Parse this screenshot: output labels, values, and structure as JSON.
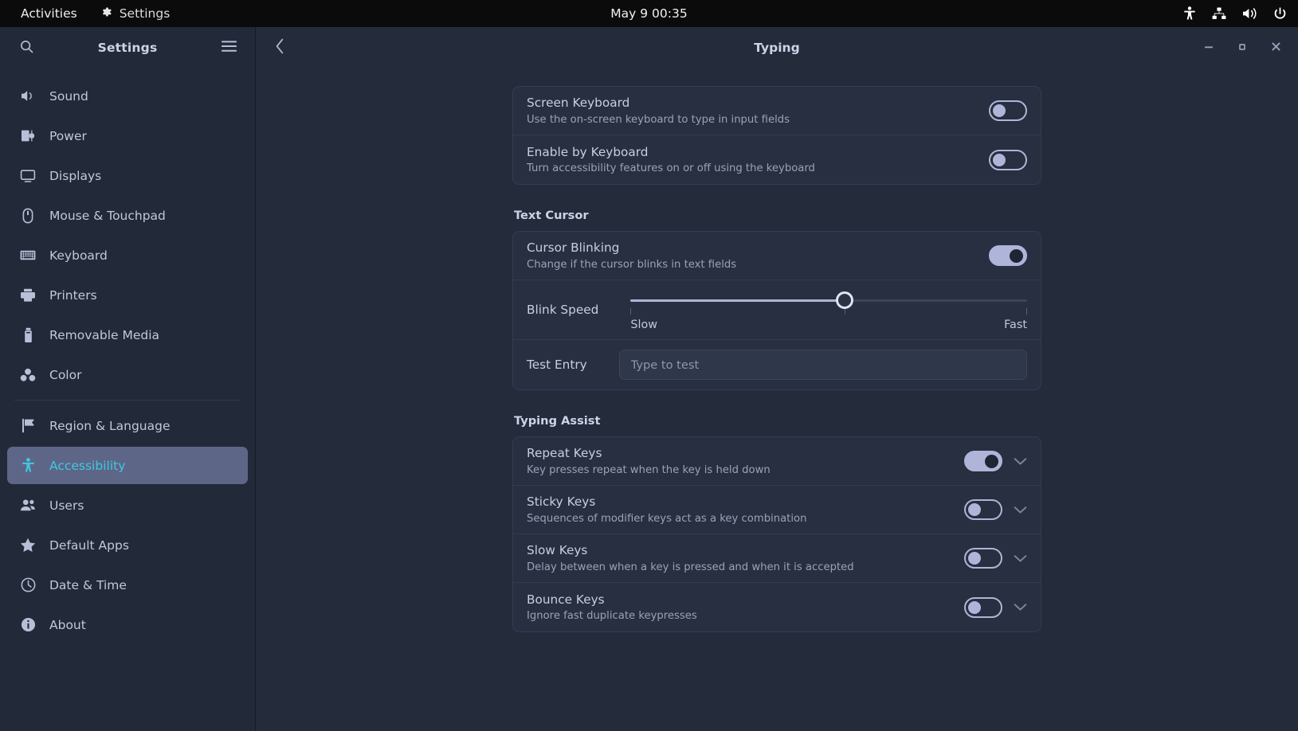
{
  "topbar": {
    "activities_label": "Activities",
    "app_name": "Settings",
    "app_icon": "gear-icon",
    "clock": "May 9  00:35",
    "indicators": [
      {
        "name": "accessibility-icon"
      },
      {
        "name": "network-icon"
      },
      {
        "name": "volume-icon"
      },
      {
        "name": "power-icon"
      }
    ]
  },
  "sidebar": {
    "title": "Settings",
    "search_icon": "search-icon",
    "menu_icon": "hamburger-menu-icon",
    "items": [
      {
        "label": "Sound",
        "icon": "sound-icon",
        "selected": false
      },
      {
        "label": "Power",
        "icon": "power-plug-icon",
        "selected": false
      },
      {
        "label": "Displays",
        "icon": "display-icon",
        "selected": false
      },
      {
        "label": "Mouse & Touchpad",
        "icon": "mouse-icon",
        "selected": false
      },
      {
        "label": "Keyboard",
        "icon": "keyboard-icon",
        "selected": false
      },
      {
        "label": "Printers",
        "icon": "printer-icon",
        "selected": false
      },
      {
        "label": "Removable Media",
        "icon": "usb-drive-icon",
        "selected": false
      },
      {
        "label": "Color",
        "icon": "color-icon",
        "selected": false
      },
      {
        "label": "Region & Language",
        "icon": "flag-icon",
        "selected": false
      },
      {
        "label": "Accessibility",
        "icon": "accessibility-icon",
        "selected": true
      },
      {
        "label": "Users",
        "icon": "users-icon",
        "selected": false
      },
      {
        "label": "Default Apps",
        "icon": "star-icon",
        "selected": false
      },
      {
        "label": "Date & Time",
        "icon": "clock-icon",
        "selected": false
      },
      {
        "label": "About",
        "icon": "info-icon",
        "selected": false
      }
    ]
  },
  "window": {
    "title": "Typing",
    "back_icon": "chevron-left-icon",
    "minimize_icon": "minimize-icon",
    "maximize_icon": "maximize-icon",
    "close_icon": "close-icon"
  },
  "keyboard_group": {
    "rows": [
      {
        "title": "Screen Keyboard",
        "subtitle": "Use the on-screen keyboard to type in input fields",
        "toggle": "off"
      },
      {
        "title": "Enable by Keyboard",
        "subtitle": "Turn accessibility features on or off using the keyboard",
        "toggle": "off"
      }
    ]
  },
  "text_cursor": {
    "section_title": "Text Cursor",
    "cursor_blinking": {
      "title": "Cursor Blinking",
      "subtitle": "Change if the cursor blinks in text fields",
      "toggle": "on"
    },
    "blink_speed": {
      "label": "Blink Speed",
      "min_label": "Slow",
      "max_label": "Fast",
      "value_percent": 54
    },
    "test_entry": {
      "label": "Test Entry",
      "value": "",
      "placeholder": "Type to test"
    }
  },
  "typing_assist": {
    "section_title": "Typing Assist",
    "rows": [
      {
        "title": "Repeat Keys",
        "subtitle": "Key presses repeat when the key is held down",
        "toggle": "on",
        "expand_icon": "chevron-down-icon"
      },
      {
        "title": "Sticky Keys",
        "subtitle": "Sequences of modifier keys act as a key combination",
        "toggle": "off",
        "expand_icon": "chevron-down-icon"
      },
      {
        "title": "Slow Keys",
        "subtitle": "Delay between when a key is pressed and when it is accepted",
        "toggle": "off",
        "expand_icon": "chevron-down-icon"
      },
      {
        "title": "Bounce Keys",
        "subtitle": "Ignore fast duplicate keypresses",
        "toggle": "off",
        "expand_icon": "chevron-down-icon"
      }
    ]
  },
  "colors": {
    "topbar_bg": "#0b0b0b",
    "sidebar_bg": "#222938",
    "main_bg": "#242b3b",
    "group_bg": "#272f40",
    "accent": "#3fc8e0",
    "selection_bg": "#5e6687",
    "toggle_on": "#aeb5d8"
  }
}
